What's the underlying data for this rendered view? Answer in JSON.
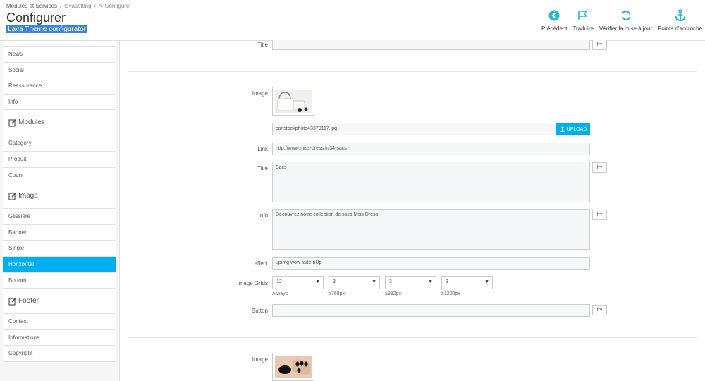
{
  "header": {
    "breadcrumb": [
      "Modules et Services",
      "lavasetting",
      "Configurer"
    ],
    "title": "Configurer",
    "subtitle": "Lava Theme configurator",
    "toolbar": [
      {
        "label": "Précédent",
        "icon": "back-circle-icon"
      },
      {
        "label": "Traduire",
        "icon": "flag-icon"
      },
      {
        "label": "Vérifier la mise à jour",
        "icon": "refresh-icon"
      },
      {
        "label": "Points d'accroche",
        "icon": "anchor-icon"
      }
    ]
  },
  "sidebar": {
    "top_items": [
      "News",
      "Social",
      "Reassurance",
      "Info"
    ],
    "groups": [
      {
        "label": "Modules",
        "icon": "edit-icon",
        "items": [
          "Category",
          "Produit",
          "Count"
        ]
      },
      {
        "label": "Image",
        "icon": "edit-icon",
        "items": [
          "Glissière",
          "Banner",
          "Single",
          "Horizontal",
          "Bottom"
        ]
      },
      {
        "label": "Footer",
        "icon": "edit-icon",
        "items": [
          "Contact",
          "Informations",
          "Copyright"
        ]
      }
    ],
    "active_item": "Horizontal"
  },
  "form": {
    "top_title_label": "Title",
    "lang_label": "fr",
    "image_label": "Image",
    "file_name": "canstockphoto43370117.jpg",
    "upload_label": "UPLOAD",
    "link_label": "Link",
    "link_value": "http://www.miss-dress.fr/34-sacs",
    "title_label": "Title",
    "title_value": "Sacs",
    "info_label": "Info",
    "info_value": "Découvrez notre collection de sacs Miss Dress",
    "effect_label": "effect",
    "effect_value": "upimg wow fadeInUp",
    "grids_label": "Image Grids",
    "grids": [
      {
        "value": "12",
        "hint": "Always"
      },
      {
        "value": "3",
        "hint": "≥768px"
      },
      {
        "value": "3",
        "hint": "≥992px"
      },
      {
        "value": "3",
        "hint": "≥1200px"
      }
    ],
    "button_label": "Button",
    "image2_label": "Image"
  },
  "colors": {
    "accent": "#00aff0",
    "subtitle_highlight": "#3d83e0"
  }
}
